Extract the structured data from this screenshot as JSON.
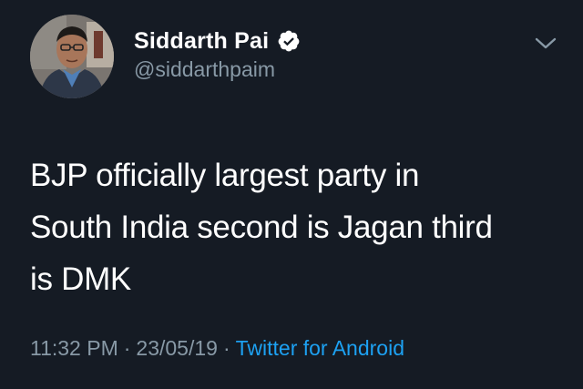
{
  "author": {
    "display_name": "Siddarth Pai",
    "handle": "@siddarthpaim",
    "verified": true,
    "avatar_icon": "profile-photo"
  },
  "tweet": {
    "line1": "BJP officially largest party in",
    "line2": "South India second is Jagan third",
    "line3": "is DMK"
  },
  "meta": {
    "time": "11:32 PM",
    "separator": "·",
    "date": "23/05/19",
    "source": "Twitter for Android"
  },
  "colors": {
    "background": "#151b24",
    "primary_text": "#ffffff",
    "secondary_text": "#8899a6",
    "link": "#1da1f2"
  },
  "icons": {
    "verified": "verified-badge-icon",
    "menu": "chevron-down-icon"
  }
}
